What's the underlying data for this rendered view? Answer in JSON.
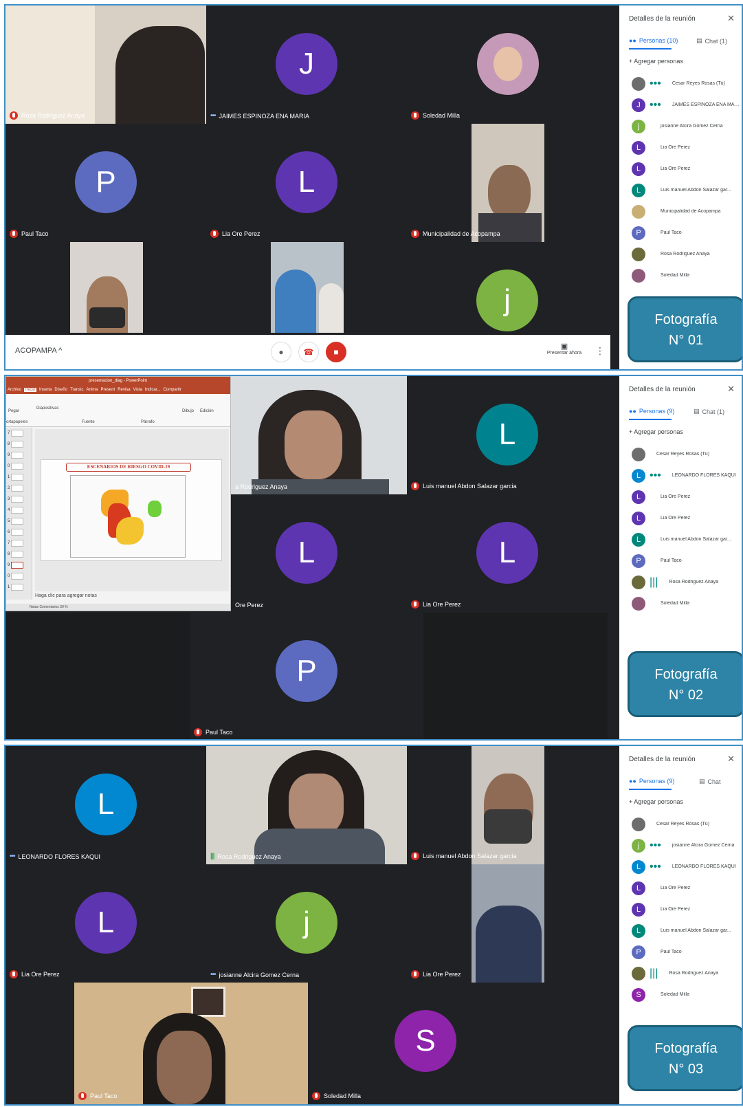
{
  "shot1": {
    "tiles": [
      {
        "name": "Rosa Rodriguez Anaya",
        "status": "muted"
      },
      {
        "name": "JAIMES ESPINOZA ENA MARIA",
        "status": "dots",
        "initial": "J",
        "color": "#5e35b1"
      },
      {
        "name": "Soledad Milla",
        "status": "muted"
      },
      {
        "name": "Paul Taco",
        "status": "muted",
        "initial": "P",
        "color": "#5c6bc0"
      },
      {
        "name": "Lia Ore Perez",
        "status": "muted",
        "initial": "L",
        "color": "#5e35b1"
      },
      {
        "name": "Municipalidad de Acopampa",
        "status": "muted"
      },
      {
        "initial": "j",
        "color": "#7cb342"
      }
    ],
    "control_bar": {
      "meeting_code": "ACOPAMPA",
      "chevron": "^",
      "present_label": "Presentar ahora"
    },
    "panel": {
      "title": "Detalles de la reunión",
      "people_tab": "Personas (10)",
      "chat_tab": "Chat (1)",
      "add_people": "Agregar personas",
      "people": [
        {
          "name": "Cesar Reyes Rosas (Tú)",
          "initial": "",
          "color": "#6d6d6d",
          "status": "dots"
        },
        {
          "name": "JAIMES ESPINOZA ENA MARIA",
          "initial": "J",
          "color": "#5e35b1",
          "status": "dots"
        },
        {
          "name": "josianne Alcira Gomez Cerna",
          "initial": "j",
          "color": "#7cb342",
          "status": "muted"
        },
        {
          "name": "Lia Ore Perez",
          "initial": "L",
          "color": "#5e35b1",
          "status": "muted"
        },
        {
          "name": "Lia Ore Perez",
          "initial": "L",
          "color": "#5e35b1",
          "status": "muted"
        },
        {
          "name": "Luis manuel Abdon Salazar gar...",
          "initial": "L",
          "color": "#00897b",
          "status": "muted"
        },
        {
          "name": "Municipalidad de Acopampa",
          "initial": "",
          "color": "#c8b074",
          "status": "muted"
        },
        {
          "name": "Paul Taco",
          "initial": "P",
          "color": "#5c6bc0",
          "status": "muted"
        },
        {
          "name": "Rosa Rodriguez Anaya",
          "initial": "",
          "color": "#6a6a3a",
          "status": "muted"
        },
        {
          "name": "Soledad Milla",
          "initial": "",
          "color": "#8e5a7a",
          "status": "muted"
        }
      ]
    },
    "badge": {
      "line1": "Fotografía",
      "line2": "N° 01"
    }
  },
  "shot2": {
    "ppt": {
      "title": "presentacion_diag - PowerPoint",
      "menu": [
        "Archivo",
        "Inicio",
        "Inserta",
        "Diseño",
        "Transic",
        "Anima",
        "Present",
        "Revisa",
        "Vista",
        "Indicar...",
        "Compartir"
      ],
      "ribbon": [
        "Pegar",
        "Diapositivas",
        "Fuente",
        "Párrafo",
        "Dibujo",
        "Edición",
        "ortapapeles"
      ],
      "slide_title": "ESCENARIOS DE RIESGO COVID-19",
      "notes": "Haga clic para agregar notas",
      "status": "Notas    Comentarios    30 %",
      "thumb_numbers": [
        "7",
        "8",
        "9",
        "0",
        "1",
        "2",
        "3",
        "4",
        "5",
        "6",
        "7",
        "8",
        "9",
        "0",
        "1"
      ]
    },
    "tiles": [
      {
        "name": "a Rodriguez Anaya",
        "status": "none"
      },
      {
        "name": "Luis manuel Abdon Salazar garcia",
        "status": "muted",
        "initial": "L",
        "color": "#00838f"
      },
      {
        "name": "Ore Perez",
        "status": "none",
        "initial": "L",
        "color": "#5e35b1"
      },
      {
        "name": "Lia Ore Perez",
        "status": "muted",
        "initial": "L",
        "color": "#5e35b1"
      },
      {
        "name": "Paul Taco",
        "status": "muted",
        "initial": "P",
        "color": "#5c6bc0"
      }
    ],
    "panel": {
      "title": "Detalles de la reunión",
      "people_tab": "Personas (9)",
      "chat_tab": "Chat (1)",
      "add_people": "Agregar personas",
      "people": [
        {
          "name": "Cesar Reyes Rosas (Tú)",
          "initial": "",
          "color": "#6d6d6d",
          "status": "none"
        },
        {
          "name": "LEONARDO FLORES KAQUI",
          "initial": "L",
          "color": "#0288d1",
          "status": "dots"
        },
        {
          "name": "Lia Ore Perez",
          "initial": "L",
          "color": "#5e35b1",
          "status": "muted"
        },
        {
          "name": "Lia Ore Perez",
          "initial": "L",
          "color": "#5e35b1",
          "status": "muted"
        },
        {
          "name": "Luis manuel Abdon Salazar gar...",
          "initial": "L",
          "color": "#00897b",
          "status": "muted"
        },
        {
          "name": "Paul Taco",
          "initial": "P",
          "color": "#5c6bc0",
          "status": "muted"
        },
        {
          "name": "Rosa Rodriguez Anaya",
          "initial": "",
          "color": "#6a6a3a",
          "status": "speaking"
        },
        {
          "name": "Soledad Milla",
          "initial": "",
          "color": "#8e5a7a",
          "status": "muted"
        }
      ]
    },
    "badge": {
      "line1": "Fotografía",
      "line2": "N° 02"
    }
  },
  "shot3": {
    "tiles": [
      {
        "name": "LEONARDO FLORES KAQUI",
        "status": "dots",
        "initial": "L",
        "color": "#0288d1"
      },
      {
        "name": "Rosa Rodriguez Anaya",
        "status": "speaking"
      },
      {
        "name": "Luis manuel Abdon Salazar garcia",
        "status": "muted"
      },
      {
        "name": "Lia Ore Perez",
        "status": "muted",
        "initial": "L",
        "color": "#5e35b1"
      },
      {
        "name": "josianne Alcira Gomez Cerna",
        "status": "dots",
        "initial": "j",
        "color": "#7cb342"
      },
      {
        "name": "Lia Ore Perez",
        "status": "muted"
      },
      {
        "name": "Paul Taco",
        "status": "muted"
      },
      {
        "name": "Soledad Milla",
        "status": "muted",
        "initial": "S",
        "color": "#8e24aa"
      }
    ],
    "panel": {
      "title": "Detalles de la reunión",
      "people_tab": "Personas (9)",
      "chat_tab": "Chat",
      "add_people": "Agregar personas",
      "people": [
        {
          "name": "Cesar Reyes Rosas (Tú)",
          "initial": "",
          "color": "#6d6d6d",
          "status": "none"
        },
        {
          "name": "josianne Alcira Gomez Cerna",
          "initial": "j",
          "color": "#7cb342",
          "status": "dots"
        },
        {
          "name": "LEONARDO FLORES KAQUI",
          "initial": "L",
          "color": "#0288d1",
          "status": "dots"
        },
        {
          "name": "Lia Ore Perez",
          "initial": "L",
          "color": "#5e35b1",
          "status": "muted"
        },
        {
          "name": "Lia Ore Perez",
          "initial": "L",
          "color": "#5e35b1",
          "status": "muted"
        },
        {
          "name": "Luis manuel Abdon Salazar gar...",
          "initial": "L",
          "color": "#00897b",
          "status": "muted"
        },
        {
          "name": "Paul Taco",
          "initial": "P",
          "color": "#5c6bc0",
          "status": "muted"
        },
        {
          "name": "Rosa Rodriguez Anaya",
          "initial": "",
          "color": "#6a6a3a",
          "status": "speaking"
        },
        {
          "name": "Soledad Milla",
          "initial": "S",
          "color": "#8e24aa",
          "status": "muted"
        }
      ]
    },
    "badge": {
      "line1": "Fotografía",
      "line2": "N° 03"
    }
  }
}
